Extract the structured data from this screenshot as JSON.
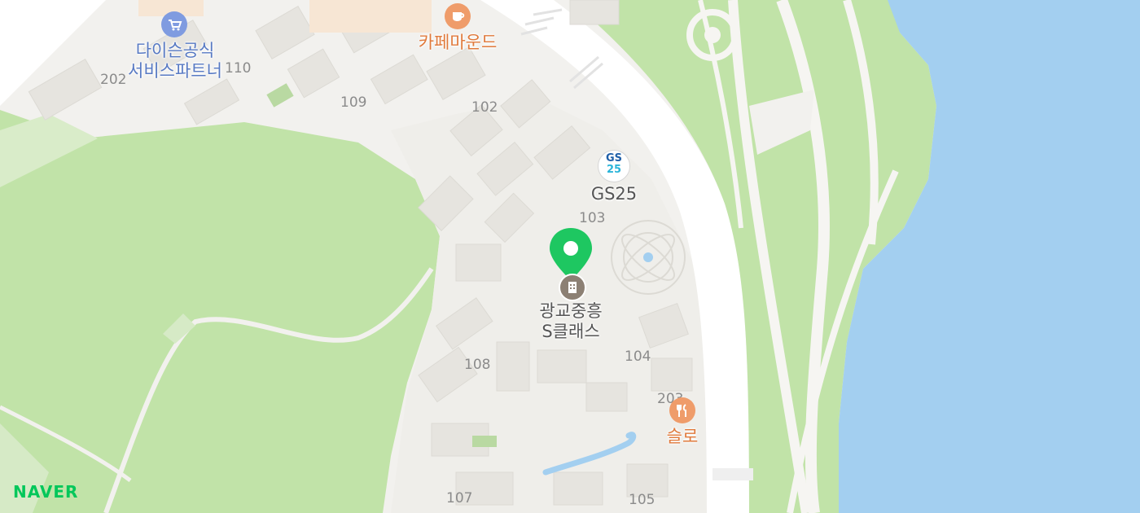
{
  "map": {
    "brand": "NAVER",
    "colors": {
      "park": "#c1e3a8",
      "water": "#a3cff0",
      "land": "#f2f1ee",
      "road": "#ffffff",
      "building": "#e6e4df",
      "marker": "#1ec761",
      "shop_poi": "#5779c3",
      "food_poi": "#e07a3c",
      "place_poi": "#8c8074",
      "naver_brand": "#03c75a"
    },
    "marker_label_line1": "광교중흥",
    "marker_label_line2": "S클래스",
    "pois": [
      {
        "id": "daiso",
        "name_line1": "다이슨공식",
        "name_line2": "서비스파트너",
        "icon": "cart-icon",
        "category": "shop"
      },
      {
        "id": "cafe",
        "name_line1": "카페마운드",
        "icon": "coffee-cup-icon",
        "category": "cafe"
      },
      {
        "id": "gs25",
        "name_line1": "GS25",
        "icon": "gs25-logo-icon",
        "icon_text_top": "GS",
        "icon_text_bottom": "25",
        "category": "convenience"
      },
      {
        "id": "sullo",
        "name_line1": "슬로",
        "icon": "fork-knife-icon",
        "category": "restaurant"
      }
    ],
    "building_numbers": [
      "202",
      "110",
      "109",
      "102",
      "103",
      "104",
      "108",
      "107",
      "105",
      "203"
    ]
  }
}
